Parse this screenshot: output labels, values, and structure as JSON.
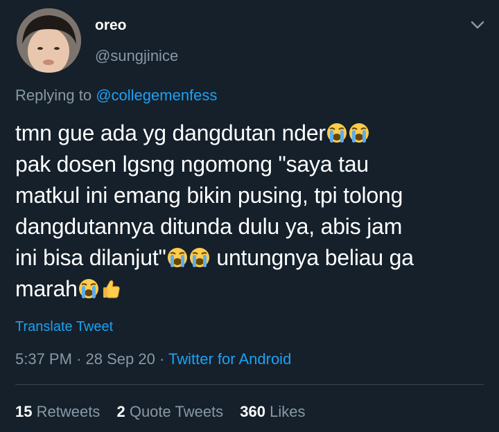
{
  "author": {
    "display_name": "oreo",
    "handle": "@sungjinice",
    "avatar_icon": "user-avatar-photo"
  },
  "menu_icon": "chevron-down-icon",
  "reply": {
    "prefix": "Replying to",
    "mention": "@collegemenfess"
  },
  "tweet": {
    "lines": [
      "tmn gue ada yg dangdutan nder",
      "pak dosen lgsng ngomong \"saya tau",
      "matkul ini emang bikin pusing, tpi tolong",
      "dangdutannya ditunda dulu ya, abis jam",
      "ini bisa dilanjut\"",
      " untungnya beliau ga",
      "marah"
    ],
    "emoji": [
      "loudly-crying-face",
      "thumbs-up"
    ]
  },
  "translate_label": "Translate Tweet",
  "meta": {
    "time": "5:37 PM",
    "separator": "·",
    "date": "28 Sep 20",
    "source": "Twitter for Android"
  },
  "stats": {
    "retweets_count": "15",
    "retweets_label": "Retweets",
    "quotes_count": "2",
    "quotes_label": "Quote Tweets",
    "likes_count": "360",
    "likes_label": "Likes"
  },
  "colors": {
    "background": "#15202b",
    "link": "#1da1f2",
    "secondary": "#8899a6",
    "divider": "#38444d"
  }
}
